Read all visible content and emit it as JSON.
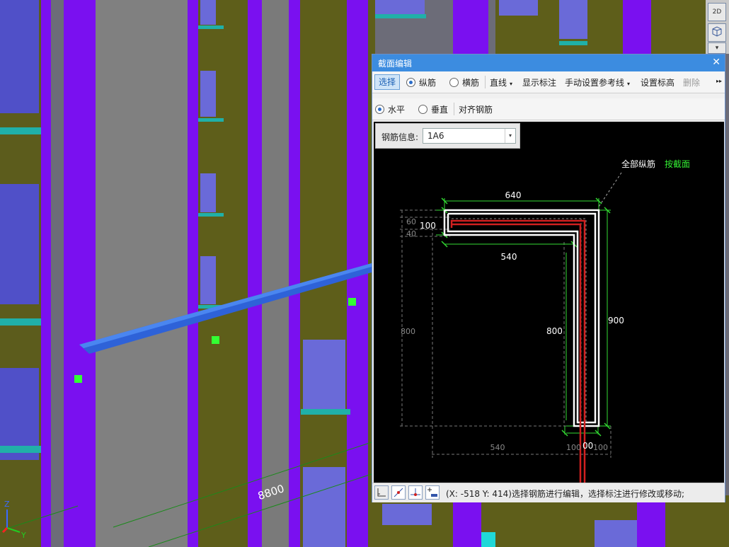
{
  "viewport": {
    "dimension_label": "8800",
    "view_buttons": [
      "2D",
      "",
      ""
    ],
    "axis": {
      "z": "Z",
      "y": "Y"
    }
  },
  "dialog": {
    "title": "截面编辑",
    "close_label": "✕",
    "toolbar1": {
      "select_label": "选择",
      "longitudinal_label": "纵筋",
      "transverse_label": "横筋",
      "line_label": "直线",
      "show_annotation_label": "显示标注",
      "manual_guide_label": "手动设置参考线",
      "set_elevation_label": "设置标高",
      "delete_label": "删除",
      "more_label": "▸▸"
    },
    "toolbar2": {
      "horizontal_label": "水平",
      "vertical_label": "垂直",
      "align_rebar_label": "对齐钢筋"
    },
    "rebar_info": {
      "label": "钢筋信息:",
      "value": "1A6"
    },
    "canvas": {
      "all_longitudinal_label": "全部纵筋",
      "by_section_label": "按截面",
      "dims": {
        "top": "640",
        "inner": "540",
        "left_100": "100",
        "left_60": "60",
        "left_40": "40",
        "right_900": "900",
        "inner_800": "800",
        "ghost_800": "800",
        "bottom_540": "540",
        "bottom_100a": "100",
        "bottom_00": "00",
        "bottom_100b": "100"
      }
    },
    "status": {
      "text": "(X: -518 Y: 414)选择钢筋进行编辑，选择标注进行修改或移动;"
    }
  },
  "colors": {
    "title_bar": "#3c8ce0",
    "building_purple": "#7a10f0",
    "building_olive": "#60601a",
    "beam_blue": "#2e62d8",
    "dim_green": "#33dd33",
    "rebar_red": "#d02020"
  }
}
